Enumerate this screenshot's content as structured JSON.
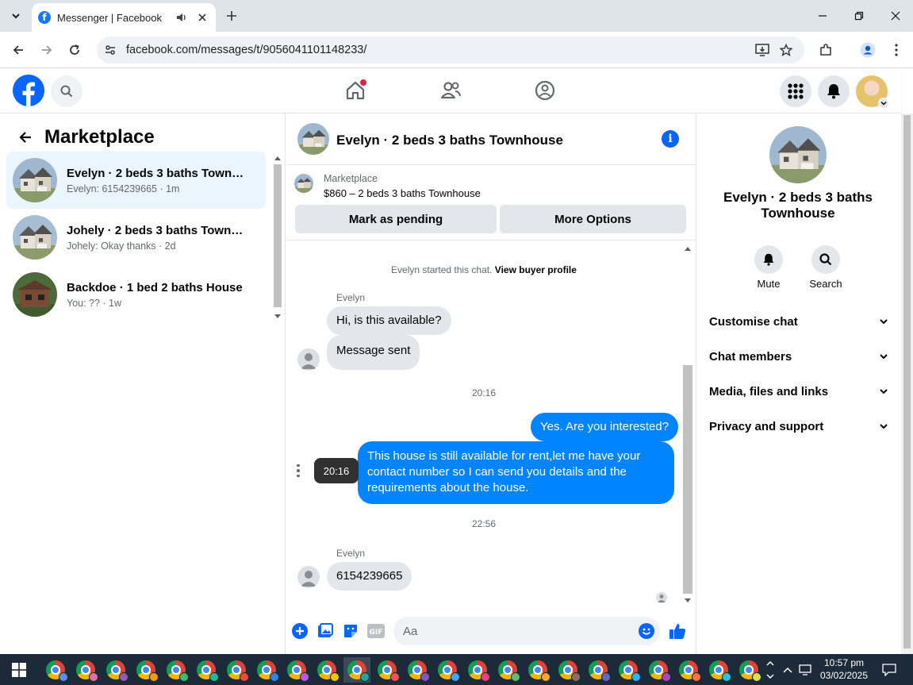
{
  "browser": {
    "tab_title": "Messenger | Facebook",
    "url": "facebook.com/messages/t/9056041101148233/"
  },
  "left_panel": {
    "title": "Marketplace",
    "conversations": [
      {
        "name": "Evelyn · 2 beds 3 baths Townhouse",
        "snippet": "Evelyn: 6154239665 · 1m"
      },
      {
        "name": "Johely · 2 beds 3 baths Townhouse",
        "snippet": "Johely: Okay thanks · 2d"
      },
      {
        "name": "Backdoe · 1 bed 2 baths House",
        "snippet": "You: ?? · 1w"
      }
    ]
  },
  "chat": {
    "title": "Evelyn · 2 beds 3 baths Townhouse",
    "banner_label": "Marketplace",
    "banner_price": "$860 – 2 beds 3 baths Townhouse",
    "mark_pending_label": "Mark as pending",
    "more_options_label": "More Options",
    "system_text": "Evelyn started this chat.",
    "system_link": "View buyer profile",
    "sender_name": "Evelyn",
    "msg_1": "Hi, is this available?",
    "msg_2": "Message sent",
    "time_1": "20:16",
    "msg_3": "Yes. Are you interested?",
    "msg_4": "This house is still available for rent,let me have your contact number so I can send you details and the requirements about the house.",
    "hover_time": "20:16",
    "time_2": "22:56",
    "sender_name_2": "Evelyn",
    "msg_5": "6154239665",
    "input_placeholder": "Aa"
  },
  "right_panel": {
    "name": "Evelyn · 2 beds 3 baths Townhouse",
    "mute_label": "Mute",
    "search_label": "Search",
    "sections": [
      "Customise chat",
      "Chat members",
      "Media, files and links",
      "Privacy and support"
    ]
  },
  "taskbar": {
    "time": "10:57 pm",
    "date": "03/02/2025"
  },
  "colors": {
    "fb_blue": "#0866ff",
    "messenger_blue": "#0084ff",
    "active_conv": "#ebf5ff"
  }
}
